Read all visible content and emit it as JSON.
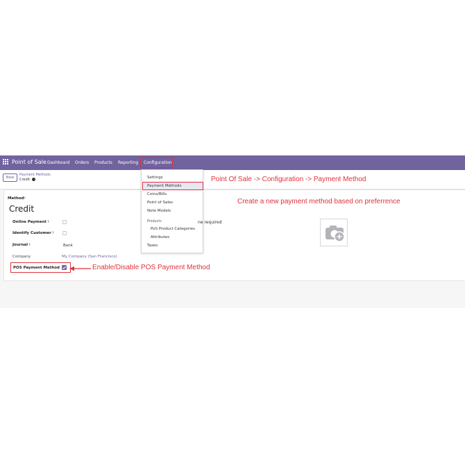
{
  "navbar": {
    "brand": "Point of Sale",
    "menu": [
      "Dashboard",
      "Orders",
      "Products",
      "Reporting",
      "Configuration"
    ]
  },
  "control_panel": {
    "new_label": "New",
    "breadcrumb_parent": "Payment Methods",
    "breadcrumb_current": "Credit"
  },
  "config_menu": {
    "items": [
      "Settings",
      "Payment Methods",
      "Coins/Bills",
      "Point of Sales",
      "Note Models"
    ],
    "products_header": "Products",
    "products_items": [
      "PoS Product Categories",
      "Attributes"
    ],
    "taxes": "Taxes",
    "active_index": 1
  },
  "form": {
    "method_label": "Method",
    "method_name": "Credit",
    "online_payment_label": "Online Payment",
    "online_payment_checked": false,
    "identify_customer_label": "Identify Customer",
    "identify_customer_checked": false,
    "journal_label": "Journal",
    "journal_value": "Bank",
    "company_label": "Company",
    "company_value": "My Company (San Francisco)",
    "pos_payment_method_label": "POS Payment Method",
    "pos_payment_method_checked": true,
    "partial_hidden_text": "ne required"
  },
  "annotations": {
    "menu_path": "Point Of Sale -> Configuration -> Payment Method",
    "create_method": "Create a new payment method based on preferrence",
    "enable_disable": "Enable/Disable POS Payment Method"
  },
  "colors": {
    "brand": "#71639e",
    "annotation": "#e0323c"
  },
  "icons": {
    "apps": "apps-grid-icon",
    "gear": "gear-icon",
    "checkbox": "checkmark-icon",
    "camera": "camera-plus-icon"
  }
}
